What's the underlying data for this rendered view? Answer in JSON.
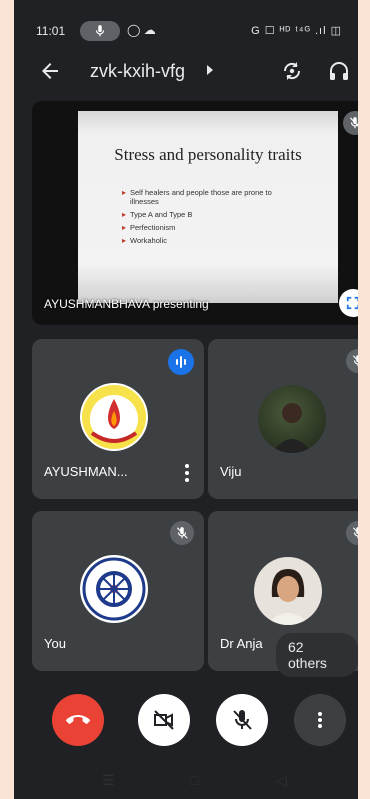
{
  "status_bar": {
    "time": "11:01",
    "indicators": "G ☐ ᴴᴰ ᵗ⁴ᴳ .ıl ◫",
    "status_icons": "◯ ☁"
  },
  "meeting": {
    "code": "zvk-kxih-vfg"
  },
  "presentation": {
    "slide_title": "Stress and personality traits",
    "bullets": [
      "Self healers and people those are prone to illnesses",
      "Type A and Type B",
      "Perfectionism",
      "Workaholic"
    ],
    "presenter_label": "AYUSHMANBHAVA presenting"
  },
  "participants": [
    {
      "name": "AYUSHMAN...",
      "state": "speaking"
    },
    {
      "name": "Viju",
      "state": "muted"
    },
    {
      "name": "You",
      "state": "muted"
    },
    {
      "name": "Dr Anja",
      "state": "muted"
    }
  ],
  "others": "62 others",
  "colors": {
    "end_call": "#ea4335",
    "speaking": "#1a73e8",
    "tile": "#3c4043",
    "background": "#202124"
  },
  "icons": [
    "back-arrow-icon",
    "switch-camera-icon",
    "headphones-icon",
    "mic-off-icon",
    "audio-wave-icon",
    "more-vert-icon",
    "fullscreen-icon",
    "end-call-icon",
    "camera-off-icon",
    "mic-off-icon",
    "more-vert-icon"
  ]
}
